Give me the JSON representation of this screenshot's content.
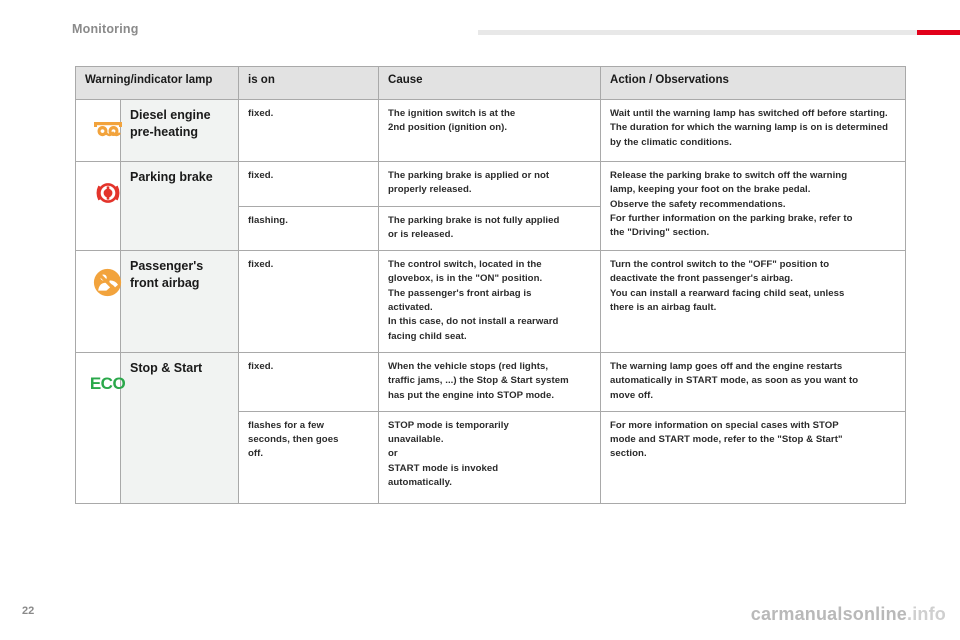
{
  "header": {
    "chapter_title": "Monitoring",
    "accent_color": "#e2001a",
    "rule_color": "#e8e8e8"
  },
  "table": {
    "columns": [
      {
        "key": "lamp",
        "label": "Warning/indicator lamp"
      },
      {
        "key": "is_on",
        "label": "is on"
      },
      {
        "key": "cause",
        "label": "Cause"
      },
      {
        "key": "action",
        "label": "Action / Observations"
      }
    ],
    "rows": [
      {
        "icon": "glow-plug-preheating-icon",
        "icon_color": "#f2a33c",
        "name": "Diesel engine\npre-heating",
        "name_line1": "Diesel engine",
        "name_line2": "pre-heating",
        "states": [
          {
            "is_on": "fixed.",
            "cause": "The ignition switch is at the\n2nd position (ignition on).",
            "action": "Wait until the warning lamp has switched off before starting.\nThe duration for which the warning lamp is on is determined\nby the climatic conditions."
          }
        ]
      },
      {
        "icon": "parking-brake-icon",
        "icon_color": "#e3342b",
        "name": "Parking brake",
        "name_line1": "Parking brake",
        "name_line2": "",
        "states": [
          {
            "is_on": "fixed.",
            "cause": "The parking brake is applied or not\nproperly released.",
            "action": "Release the parking brake to switch off the warning\nlamp, keeping your foot on the brake pedal.\nObserve the safety recommendations.\nFor further information on the parking brake, refer to\nthe \"Driving\" section."
          },
          {
            "is_on": "flashing.",
            "cause": "The parking brake is not fully applied\nor is released.",
            "action": ""
          }
        ]
      },
      {
        "icon": "passenger-airbag-off-icon",
        "icon_color": "#f2a33c",
        "name": "Passenger's\nfront airbag",
        "name_line1": "Passenger's",
        "name_line2": "front airbag",
        "states": [
          {
            "is_on": "fixed.",
            "cause": "The control switch, located in the\nglovebox, is in the \"ON\" position.\nThe passenger's front airbag is\nactivated.\nIn this case, do not install a rearward\nfacing child seat.",
            "action": "Turn the control switch to the \"OFF\" position to\ndeactivate the front passenger's airbag.\nYou can install a rearward facing child seat, unless\nthere is an airbag fault."
          }
        ]
      },
      {
        "icon": "eco-stop-start-icon",
        "icon_color": "#2aa84a",
        "icon_text": "ECO",
        "name": "Stop & Start",
        "name_line1": "Stop & Start",
        "name_line2": "",
        "states": [
          {
            "is_on": "fixed.",
            "cause": "When the vehicle stops (red lights,\ntraffic jams, ...) the Stop & Start system\nhas put the engine into STOP mode.",
            "action": "The warning lamp goes off and the engine restarts\nautomatically in START mode, as soon as you want to\nmove off."
          },
          {
            "is_on": "flashes for a few\nseconds, then goes\noff.",
            "cause": "STOP mode is temporarily\nunavailable.\nor\nSTART mode is invoked\nautomatically.",
            "action": "For more information on special cases with STOP\nmode and START mode, refer to the \"Stop & Start\"\nsection."
          }
        ]
      }
    ]
  },
  "footer": {
    "page_number": "22",
    "watermark": "carmanualsonline.info",
    "watermark_main": "carmanualsonline",
    "watermark_suffix": ".info"
  }
}
